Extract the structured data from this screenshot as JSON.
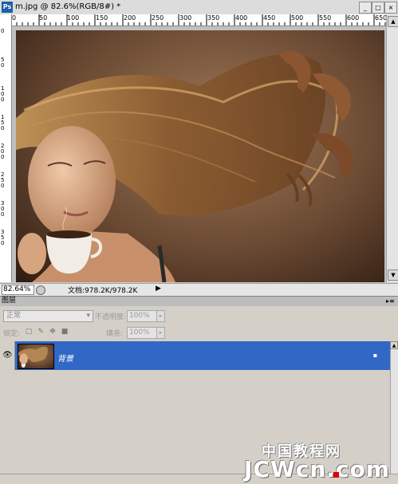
{
  "window": {
    "app_icon": "Ps",
    "title": "m.jpg @ 82.6%(RGB/8#)  *",
    "buttons": {
      "minimize": "_",
      "maximize": "□",
      "close": "×"
    }
  },
  "ruler": {
    "top_labels": [
      "0",
      "50",
      "100",
      "150",
      "200",
      "250",
      "300",
      "350",
      "400",
      "450",
      "500",
      "550",
      "600",
      "650"
    ],
    "left_labels": [
      "0",
      "50",
      "100",
      "150",
      "200",
      "250",
      "300",
      "350"
    ]
  },
  "status": {
    "zoom": "82.64%",
    "doc_info": "文档:978.2K/978.2K",
    "arrow": "▶"
  },
  "layers_panel": {
    "tab": "图层",
    "blend_mode": "正常",
    "opacity_label": "不透明度:",
    "opacity_value": "100%",
    "lock_label": "锁定:",
    "fill_label": "填充:",
    "fill_value": "100%",
    "layers": [
      {
        "name": "背景",
        "visible": true,
        "locked": true
      }
    ]
  },
  "watermark": {
    "line1": "中国教程网",
    "line2": "JCWcn.com"
  },
  "icons": {
    "eye": "eye-icon",
    "lock": "lock-icon",
    "ps": "photoshop-icon"
  },
  "colors": {
    "selection": "#3168c6",
    "panel_bg": "#d4d0c8"
  }
}
